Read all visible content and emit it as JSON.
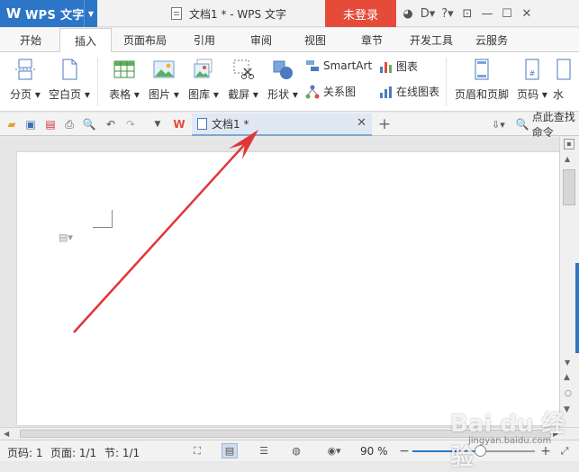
{
  "titlebar": {
    "app_name": "WPS 文字",
    "app_logo": "W",
    "doc_title": "文档1 * - WPS 文字",
    "login_label": "未登录"
  },
  "tabs": [
    "开始",
    "插入",
    "页面布局",
    "引用",
    "审阅",
    "视图",
    "章节",
    "开发工具",
    "云服务"
  ],
  "active_tab": "插入",
  "ribbon": {
    "page_break": "分页",
    "blank_page": "空白页",
    "table": "表格",
    "picture": "图片",
    "gallery": "图库",
    "screenshot": "截屏",
    "shapes": "形状",
    "smartart": "SmartArt",
    "chart": "图表",
    "relation_chart": "关系图",
    "online_chart": "在线图表",
    "header_footer": "页眉和页脚",
    "page_number": "页码",
    "watermark_partial": "水"
  },
  "doc_tab": {
    "title": "文档1 *"
  },
  "find_command": "点此查找命令",
  "status": {
    "page_number": "页码: 1",
    "pages": "页面: 1/1",
    "section": "节: 1/1",
    "zoom": "90 %",
    "zoom_level": 0.55
  },
  "colors": {
    "accent": "#2d75c6",
    "login": "#e64b3a",
    "arrow": "#e03636"
  },
  "watermark": {
    "text": "Bai du 经验",
    "sub": "jingyan.baidu.com"
  }
}
